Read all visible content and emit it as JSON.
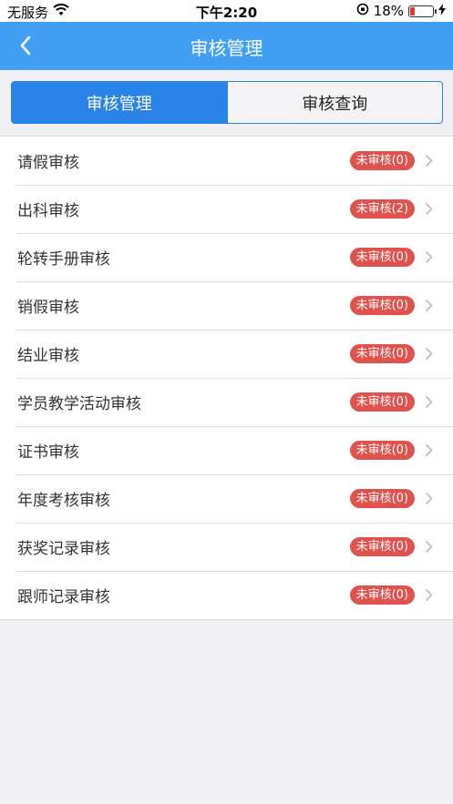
{
  "status_bar": {
    "carrier": "无服务",
    "time": "下午2:20",
    "battery_percent": "18%",
    "battery_level": 0.18
  },
  "nav": {
    "title": "审核管理",
    "back_icon": "chevron-left-icon"
  },
  "tabs": [
    {
      "label": "审核管理",
      "active": true
    },
    {
      "label": "审核查询",
      "active": false
    }
  ],
  "items": [
    {
      "label": "请假审核",
      "badge": "未审核(0)"
    },
    {
      "label": "出科审核",
      "badge": "未审核(2)"
    },
    {
      "label": "轮转手册审核",
      "badge": "未审核(0)"
    },
    {
      "label": "销假审核",
      "badge": "未审核(0)"
    },
    {
      "label": "结业审核",
      "badge": "未审核(0)"
    },
    {
      "label": "学员教学活动审核",
      "badge": "未审核(0)"
    },
    {
      "label": "证书审核",
      "badge": "未审核(0)"
    },
    {
      "label": "年度考核审核",
      "badge": "未审核(0)"
    },
    {
      "label": "获奖记录审核",
      "badge": "未审核(0)"
    },
    {
      "label": "跟师记录审核",
      "badge": "未审核(0)"
    }
  ],
  "colors": {
    "nav_bg": "#41a0f4",
    "tab_active": "#2a83e6",
    "badge_bg": "#e0524e"
  }
}
